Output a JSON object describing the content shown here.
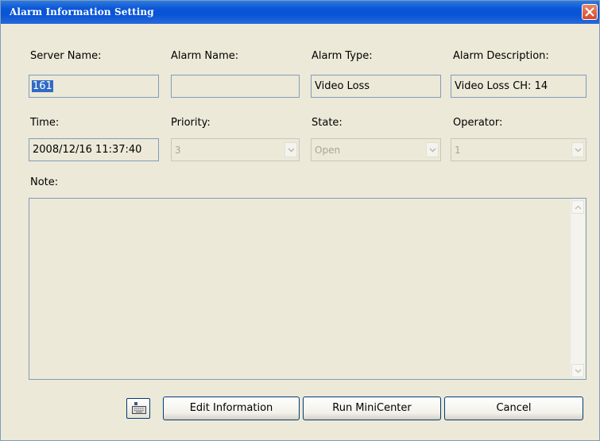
{
  "window": {
    "title": "Alarm Information Setting"
  },
  "fields": {
    "server_name": {
      "label": "Server Name:",
      "value": "161"
    },
    "alarm_name": {
      "label": "Alarm Name:",
      "value": ""
    },
    "alarm_type": {
      "label": "Alarm Type:",
      "value": "Video Loss"
    },
    "alarm_description": {
      "label": "Alarm Description:",
      "value": "Video Loss CH: 14"
    },
    "time": {
      "label": "Time:",
      "value": "2008/12/16 11:37:40"
    },
    "priority": {
      "label": "Priority:",
      "value": "3"
    },
    "state": {
      "label": "State:",
      "value": "Open"
    },
    "operator": {
      "label": "Operator:",
      "value": "1"
    }
  },
  "note": {
    "label": "Note:",
    "value": ""
  },
  "buttons": {
    "keyboard_icon": "keyboard-icon",
    "edit": "Edit Information",
    "run": "Run MiniCenter",
    "cancel": "Cancel"
  },
  "colors": {
    "titlebar": "#0a55d8",
    "selection": "#316ac5",
    "dialog_bg": "#ece9d8"
  }
}
